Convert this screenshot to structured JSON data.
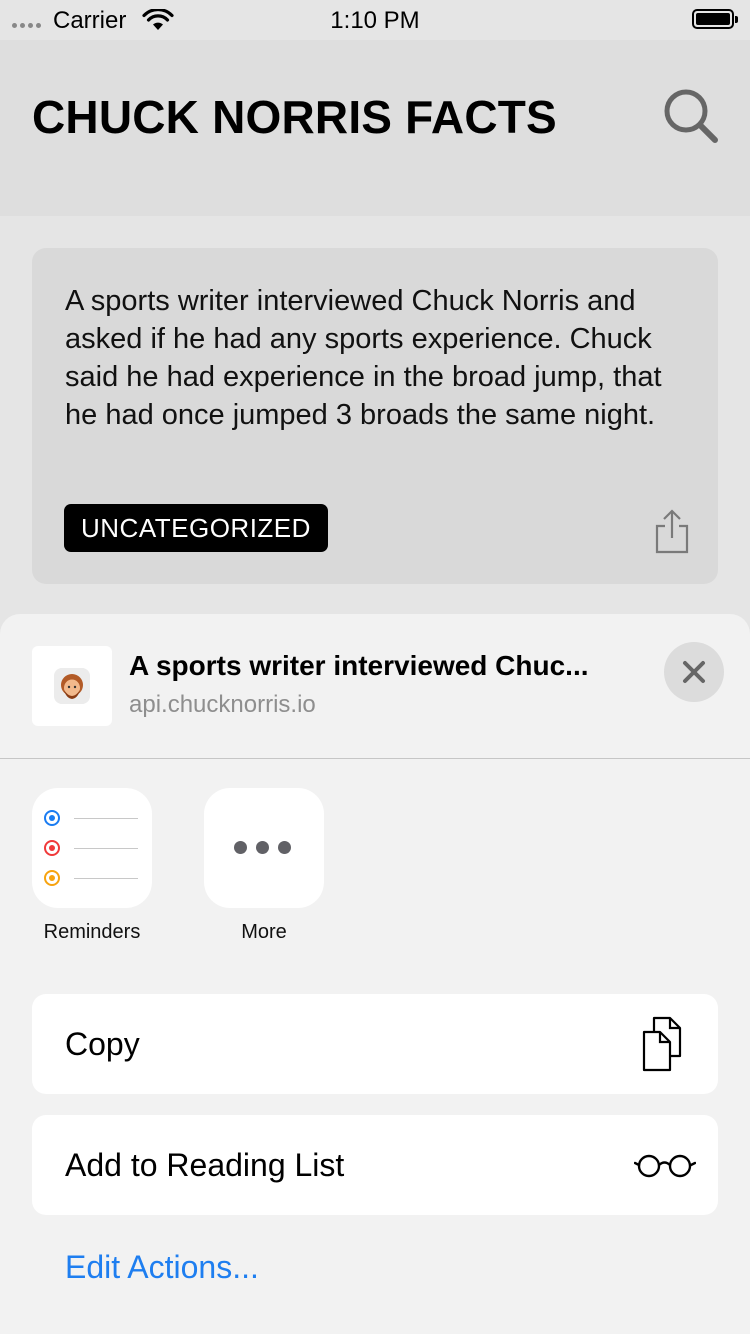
{
  "status_bar": {
    "carrier": "Carrier",
    "time": "1:10 PM",
    "icons": [
      "signal-dots-icon",
      "wifi-icon",
      "battery-icon"
    ]
  },
  "header": {
    "title": "CHUCK NORRIS FACTS",
    "search_icon": "search-icon"
  },
  "fact": {
    "text": "A sports writer interviewed Chuck Norris and asked if he had any sports experience. Chuck said he had experience in the broad jump, that he had once jumped 3 broads the same night.",
    "category": "UNCATEGORIZED",
    "share_icon": "share-icon"
  },
  "share_sheet": {
    "title": "A sports writer interviewed Chuc...",
    "url": "api.chucknorris.io",
    "close_icon": "close-icon",
    "apps": [
      {
        "label": "Reminders",
        "icon": "reminders-icon"
      },
      {
        "label": "More",
        "icon": "more-icon"
      }
    ],
    "actions": [
      {
        "label": "Copy",
        "icon": "copy-icon"
      },
      {
        "label": "Add to Reading List",
        "icon": "glasses-icon"
      }
    ],
    "edit_actions": "Edit Actions..."
  },
  "colors": {
    "background": "#e5e5e5",
    "card": "#d9d9d9",
    "badge": "#000000",
    "link": "#1e7ef0",
    "reminder_dots": [
      "#1a7cf2",
      "#f0393a",
      "#f7a30f"
    ]
  }
}
